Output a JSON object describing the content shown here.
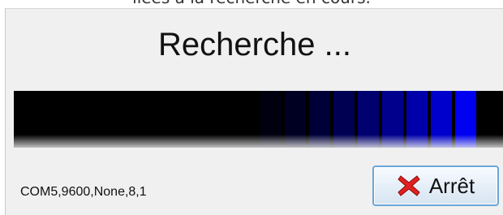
{
  "caption": "liées à la recherche en cours.",
  "dialog": {
    "title": "Recherche ...",
    "status_text": "COM5,9600,None,8,1",
    "stop_button": {
      "label": "Arrêt",
      "icon": "red-x-icon"
    }
  },
  "colors": {
    "accent_blue": "#0000ff",
    "progress_background": "#000000",
    "stop_icon": "#e02020"
  }
}
